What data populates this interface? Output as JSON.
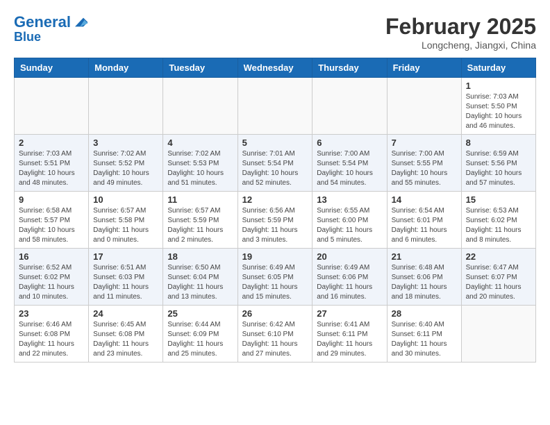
{
  "header": {
    "logo_line1": "General",
    "logo_line2": "Blue",
    "month_title": "February 2025",
    "location": "Longcheng, Jiangxi, China"
  },
  "weekdays": [
    "Sunday",
    "Monday",
    "Tuesday",
    "Wednesday",
    "Thursday",
    "Friday",
    "Saturday"
  ],
  "weeks": [
    [
      {
        "day": "",
        "info": ""
      },
      {
        "day": "",
        "info": ""
      },
      {
        "day": "",
        "info": ""
      },
      {
        "day": "",
        "info": ""
      },
      {
        "day": "",
        "info": ""
      },
      {
        "day": "",
        "info": ""
      },
      {
        "day": "1",
        "info": "Sunrise: 7:03 AM\nSunset: 5:50 PM\nDaylight: 10 hours and 46 minutes."
      }
    ],
    [
      {
        "day": "2",
        "info": "Sunrise: 7:03 AM\nSunset: 5:51 PM\nDaylight: 10 hours and 48 minutes."
      },
      {
        "day": "3",
        "info": "Sunrise: 7:02 AM\nSunset: 5:52 PM\nDaylight: 10 hours and 49 minutes."
      },
      {
        "day": "4",
        "info": "Sunrise: 7:02 AM\nSunset: 5:53 PM\nDaylight: 10 hours and 51 minutes."
      },
      {
        "day": "5",
        "info": "Sunrise: 7:01 AM\nSunset: 5:54 PM\nDaylight: 10 hours and 52 minutes."
      },
      {
        "day": "6",
        "info": "Sunrise: 7:00 AM\nSunset: 5:54 PM\nDaylight: 10 hours and 54 minutes."
      },
      {
        "day": "7",
        "info": "Sunrise: 7:00 AM\nSunset: 5:55 PM\nDaylight: 10 hours and 55 minutes."
      },
      {
        "day": "8",
        "info": "Sunrise: 6:59 AM\nSunset: 5:56 PM\nDaylight: 10 hours and 57 minutes."
      }
    ],
    [
      {
        "day": "9",
        "info": "Sunrise: 6:58 AM\nSunset: 5:57 PM\nDaylight: 10 hours and 58 minutes."
      },
      {
        "day": "10",
        "info": "Sunrise: 6:57 AM\nSunset: 5:58 PM\nDaylight: 11 hours and 0 minutes."
      },
      {
        "day": "11",
        "info": "Sunrise: 6:57 AM\nSunset: 5:59 PM\nDaylight: 11 hours and 2 minutes."
      },
      {
        "day": "12",
        "info": "Sunrise: 6:56 AM\nSunset: 5:59 PM\nDaylight: 11 hours and 3 minutes."
      },
      {
        "day": "13",
        "info": "Sunrise: 6:55 AM\nSunset: 6:00 PM\nDaylight: 11 hours and 5 minutes."
      },
      {
        "day": "14",
        "info": "Sunrise: 6:54 AM\nSunset: 6:01 PM\nDaylight: 11 hours and 6 minutes."
      },
      {
        "day": "15",
        "info": "Sunrise: 6:53 AM\nSunset: 6:02 PM\nDaylight: 11 hours and 8 minutes."
      }
    ],
    [
      {
        "day": "16",
        "info": "Sunrise: 6:52 AM\nSunset: 6:02 PM\nDaylight: 11 hours and 10 minutes."
      },
      {
        "day": "17",
        "info": "Sunrise: 6:51 AM\nSunset: 6:03 PM\nDaylight: 11 hours and 11 minutes."
      },
      {
        "day": "18",
        "info": "Sunrise: 6:50 AM\nSunset: 6:04 PM\nDaylight: 11 hours and 13 minutes."
      },
      {
        "day": "19",
        "info": "Sunrise: 6:49 AM\nSunset: 6:05 PM\nDaylight: 11 hours and 15 minutes."
      },
      {
        "day": "20",
        "info": "Sunrise: 6:49 AM\nSunset: 6:06 PM\nDaylight: 11 hours and 16 minutes."
      },
      {
        "day": "21",
        "info": "Sunrise: 6:48 AM\nSunset: 6:06 PM\nDaylight: 11 hours and 18 minutes."
      },
      {
        "day": "22",
        "info": "Sunrise: 6:47 AM\nSunset: 6:07 PM\nDaylight: 11 hours and 20 minutes."
      }
    ],
    [
      {
        "day": "23",
        "info": "Sunrise: 6:46 AM\nSunset: 6:08 PM\nDaylight: 11 hours and 22 minutes."
      },
      {
        "day": "24",
        "info": "Sunrise: 6:45 AM\nSunset: 6:08 PM\nDaylight: 11 hours and 23 minutes."
      },
      {
        "day": "25",
        "info": "Sunrise: 6:44 AM\nSunset: 6:09 PM\nDaylight: 11 hours and 25 minutes."
      },
      {
        "day": "26",
        "info": "Sunrise: 6:42 AM\nSunset: 6:10 PM\nDaylight: 11 hours and 27 minutes."
      },
      {
        "day": "27",
        "info": "Sunrise: 6:41 AM\nSunset: 6:11 PM\nDaylight: 11 hours and 29 minutes."
      },
      {
        "day": "28",
        "info": "Sunrise: 6:40 AM\nSunset: 6:11 PM\nDaylight: 11 hours and 30 minutes."
      },
      {
        "day": "",
        "info": ""
      }
    ]
  ]
}
